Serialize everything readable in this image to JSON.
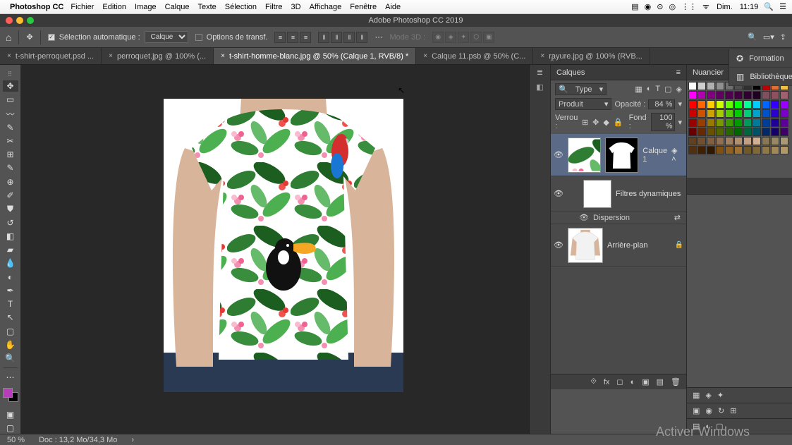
{
  "menubar": {
    "app_name": "Photoshop CC",
    "items": [
      "Fichier",
      "Edition",
      "Image",
      "Calque",
      "Texte",
      "Sélection",
      "Filtre",
      "3D",
      "Affichage",
      "Fenêtre",
      "Aide"
    ],
    "right_day": "Dim.",
    "right_time": "11:19"
  },
  "titlebar": {
    "title": "Adobe Photoshop CC 2019"
  },
  "optionsbar": {
    "auto_select_label": "Sélection automatique :",
    "auto_select_target": "Calque",
    "transform_controls": "Options de transf.",
    "mode3d": "Mode 3D :"
  },
  "tabs": [
    {
      "label": "t-shirt-perroquet.psd ...",
      "active": false
    },
    {
      "label": "perroquet.jpg @ 100% (...",
      "active": false
    },
    {
      "label": "t-shirt-homme-blanc.jpg @ 50% (Calque 1, RVB/8) *",
      "active": true
    },
    {
      "label": "Calque 11.psb @ 50% (C...",
      "active": false
    },
    {
      "label": "rayure.jpg @ 100% (RVB...",
      "active": false
    }
  ],
  "layers_panel": {
    "title": "Calques",
    "kind_label": "Type",
    "blend_mode": "Produit",
    "opacity_label": "Opacité :",
    "opacity_value": "84 %",
    "lock_label": "Verrou :",
    "fill_label": "Fond :",
    "fill_value": "100 %",
    "layers": [
      {
        "name": "Calque 1",
        "smart": true
      },
      {
        "name": "Filtres dynamiques",
        "header": true
      },
      {
        "name": "Dispersion",
        "effect": true
      },
      {
        "name": "Arrière-plan",
        "locked": true
      }
    ]
  },
  "swatches_panel": {
    "title": "Nuancier"
  },
  "right_panels": [
    {
      "icon": "✪",
      "label": "Formation"
    },
    {
      "icon": "⬚",
      "label": "Bibliothèques"
    }
  ],
  "swatch_colors": [
    "#ffffff",
    "#d0d0d0",
    "#b0b0b0",
    "#909090",
    "#707070",
    "#505050",
    "#303030",
    "#000000",
    "#c00000",
    "#e07030",
    "#f0c040",
    "#ff00ff",
    "#b000b0",
    "#800080",
    "#600060",
    "#500050",
    "#400040",
    "#300030",
    "#200020",
    "#805060",
    "#905060",
    "#a06070",
    "#ff0000",
    "#ff6600",
    "#ffcc00",
    "#ccff00",
    "#66ff00",
    "#00ff00",
    "#00ff99",
    "#00ccff",
    "#0066ff",
    "#3300ff",
    "#9900ff",
    "#cc0000",
    "#cc5200",
    "#cca300",
    "#a3cc00",
    "#52cc00",
    "#00cc00",
    "#00cc7a",
    "#00a3cc",
    "#0052cc",
    "#2900cc",
    "#7a00cc",
    "#990000",
    "#993d00",
    "#997a00",
    "#7a9900",
    "#3d9900",
    "#009900",
    "#00995c",
    "#007a99",
    "#003d99",
    "#1f0099",
    "#5c0099",
    "#660000",
    "#662900",
    "#665200",
    "#526600",
    "#296600",
    "#006600",
    "#00663d",
    "#005266",
    "#002966",
    "#140066",
    "#3d0066",
    "#604020",
    "#705030",
    "#806040",
    "#907050",
    "#a08060",
    "#b09070",
    "#c0a080",
    "#d0b090",
    "#887755",
    "#998866",
    "#aa9977",
    "#503010",
    "#402000",
    "#301800",
    "#805010",
    "#906020",
    "#a07030",
    "#705828",
    "#806838",
    "#907848",
    "#a08858",
    "#b09868"
  ],
  "statusbar": {
    "zoom": "50 %",
    "doc": "Doc : 13,2 Mo/34,3 Mo"
  },
  "watermark": "Activer Windows"
}
